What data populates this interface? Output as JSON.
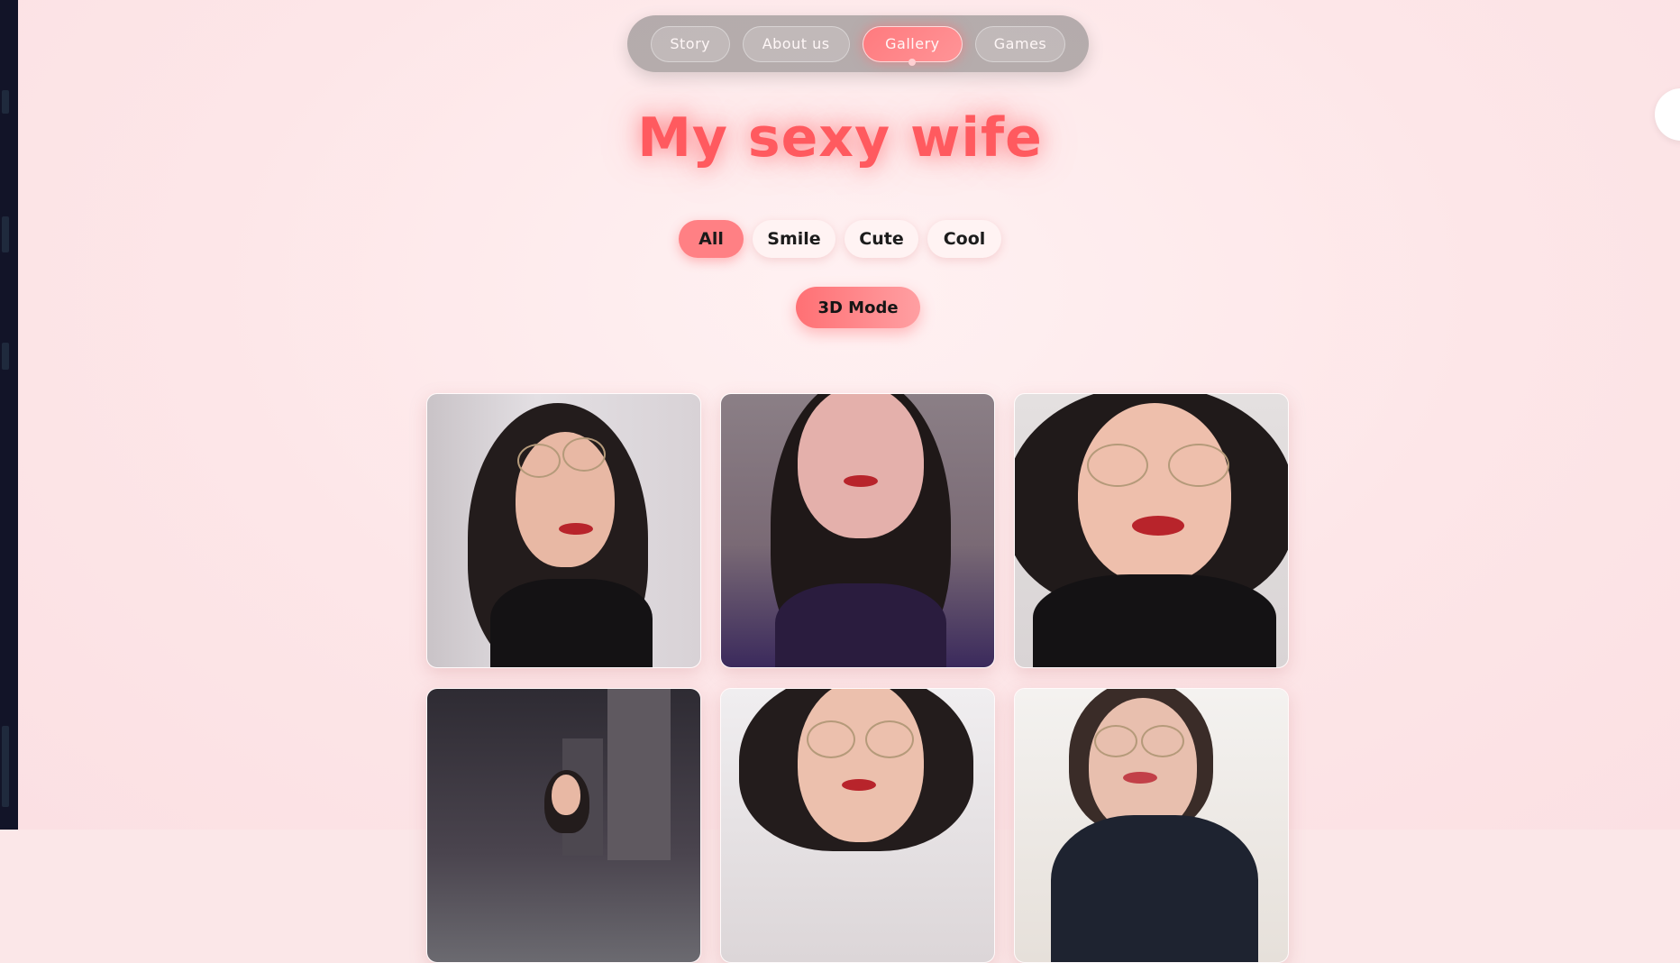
{
  "nav": {
    "items": [
      {
        "label": "Story",
        "active": false
      },
      {
        "label": "About us",
        "active": false
      },
      {
        "label": "Gallery",
        "active": true
      },
      {
        "label": "Games",
        "active": false
      }
    ]
  },
  "title": "My sexy wife",
  "filters": {
    "items": [
      {
        "label": "All",
        "active": true
      },
      {
        "label": "Smile",
        "active": false
      },
      {
        "label": "Cute",
        "active": false
      },
      {
        "label": "Cool",
        "active": false
      }
    ]
  },
  "mode_button": "3D Mode",
  "colors": {
    "accent": "#ff5a5f",
    "background": "#fde6e8",
    "chip_active": "#ff8084"
  },
  "gallery": {
    "photos": [
      {
        "name": "photo-1"
      },
      {
        "name": "photo-2"
      },
      {
        "name": "photo-3"
      },
      {
        "name": "photo-4"
      },
      {
        "name": "photo-5"
      },
      {
        "name": "photo-6"
      }
    ]
  }
}
